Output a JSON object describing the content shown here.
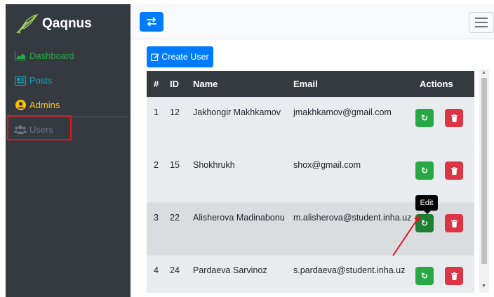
{
  "brand": {
    "name": "Qaqnus"
  },
  "sidebar": {
    "items": [
      {
        "label": "Dashboard",
        "icon": "area-chart-icon",
        "color": "#28a745"
      },
      {
        "label": "Posts",
        "icon": "newspaper-icon",
        "color": "#17a2b8"
      },
      {
        "label": "Admins",
        "icon": "user-circle-icon",
        "color": "#ffc107"
      },
      {
        "label": "Users",
        "icon": "users-icon",
        "color": "#6c757d"
      }
    ]
  },
  "toolbar": {
    "toggle_icon": "exchange-icon",
    "menu_icon": "hamburger-icon"
  },
  "main": {
    "create_label": "Create User",
    "table": {
      "columns": [
        "#",
        "ID",
        "Name",
        "Email",
        "Actions"
      ],
      "rows": [
        {
          "num": "1",
          "id": "12",
          "name": "Jakhongir Makhkamov",
          "email": "jmakhkamov@gmail.com"
        },
        {
          "num": "2",
          "id": "15",
          "name": "Shokhrukh",
          "email": "shox@gmail.com"
        },
        {
          "num": "3",
          "id": "22",
          "name": "Alisherova Madinabonu",
          "email": "m.alisherova@student.inha.uz"
        },
        {
          "num": "4",
          "id": "24",
          "name": "Pardaeva Sarvinoz",
          "email": "s.pardaeva@student.inha.uz"
        }
      ]
    },
    "tooltip": "Edit"
  },
  "colors": {
    "primary": "#007bff",
    "success": "#28a745",
    "danger": "#dc3545",
    "sidebar": "#343a40",
    "annotation": "#e3131d"
  }
}
